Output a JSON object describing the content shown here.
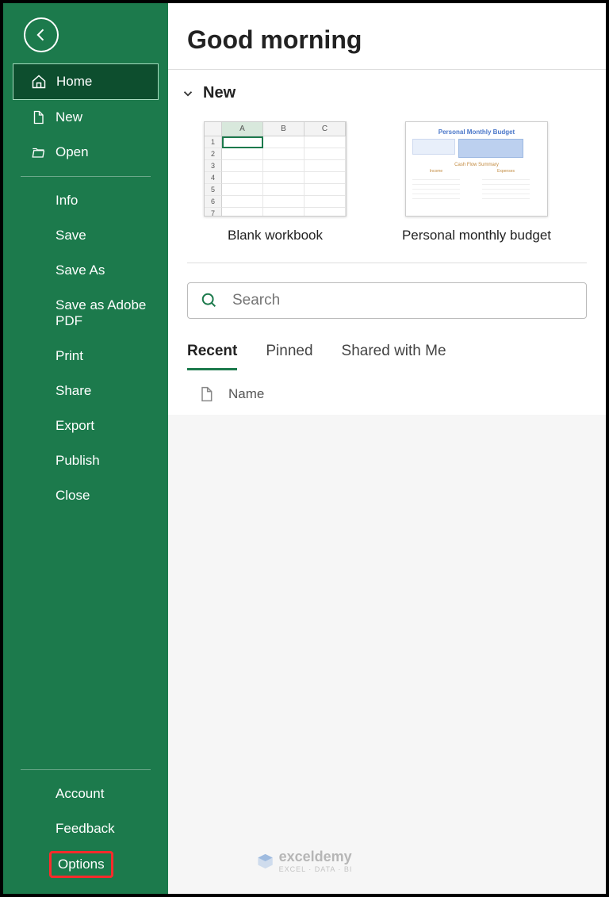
{
  "sidebar": {
    "home": "Home",
    "new": "New",
    "open": "Open",
    "info": "Info",
    "save": "Save",
    "saveAs": "Save As",
    "saveAdobe": "Save as Adobe PDF",
    "print": "Print",
    "share": "Share",
    "export": "Export",
    "publish": "Publish",
    "close": "Close",
    "account": "Account",
    "feedback": "Feedback",
    "options": "Options"
  },
  "main": {
    "greeting": "Good morning",
    "newSection": "New",
    "templates": {
      "blank": "Blank workbook",
      "budget": "Personal monthly budget",
      "budgetThumbTitle": "Personal Monthly Budget"
    },
    "search": {
      "placeholder": "Search"
    },
    "tabs": {
      "recent": "Recent",
      "pinned": "Pinned",
      "shared": "Shared with Me"
    },
    "listHeader": {
      "name": "Name"
    }
  },
  "watermark": {
    "brand": "exceldemy",
    "tagline": "EXCEL · DATA · BI"
  }
}
